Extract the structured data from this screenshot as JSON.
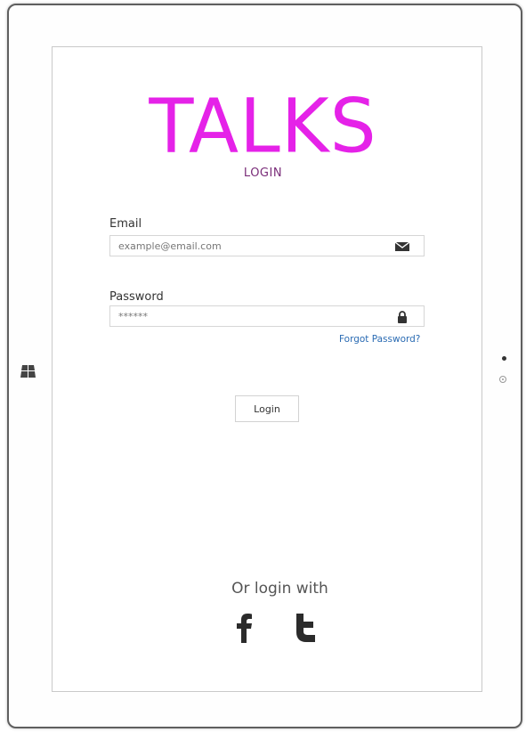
{
  "app": {
    "logo": "TALKS",
    "subtitle": "LOGIN"
  },
  "form": {
    "email_label": "Email",
    "email_placeholder": "example@email.com",
    "password_label": "Password",
    "password_value": "******",
    "forgot_label": "Forgot Password?",
    "login_label": "Login"
  },
  "social": {
    "prompt": "Or login with",
    "providers": [
      "facebook",
      "twitter"
    ]
  },
  "icons": {
    "email": "envelope-icon",
    "password": "lock-icon",
    "home": "windows-icon"
  },
  "colors": {
    "brand": "#e522e8",
    "subtitle": "#7a2d79",
    "link": "#2a6bb3"
  }
}
